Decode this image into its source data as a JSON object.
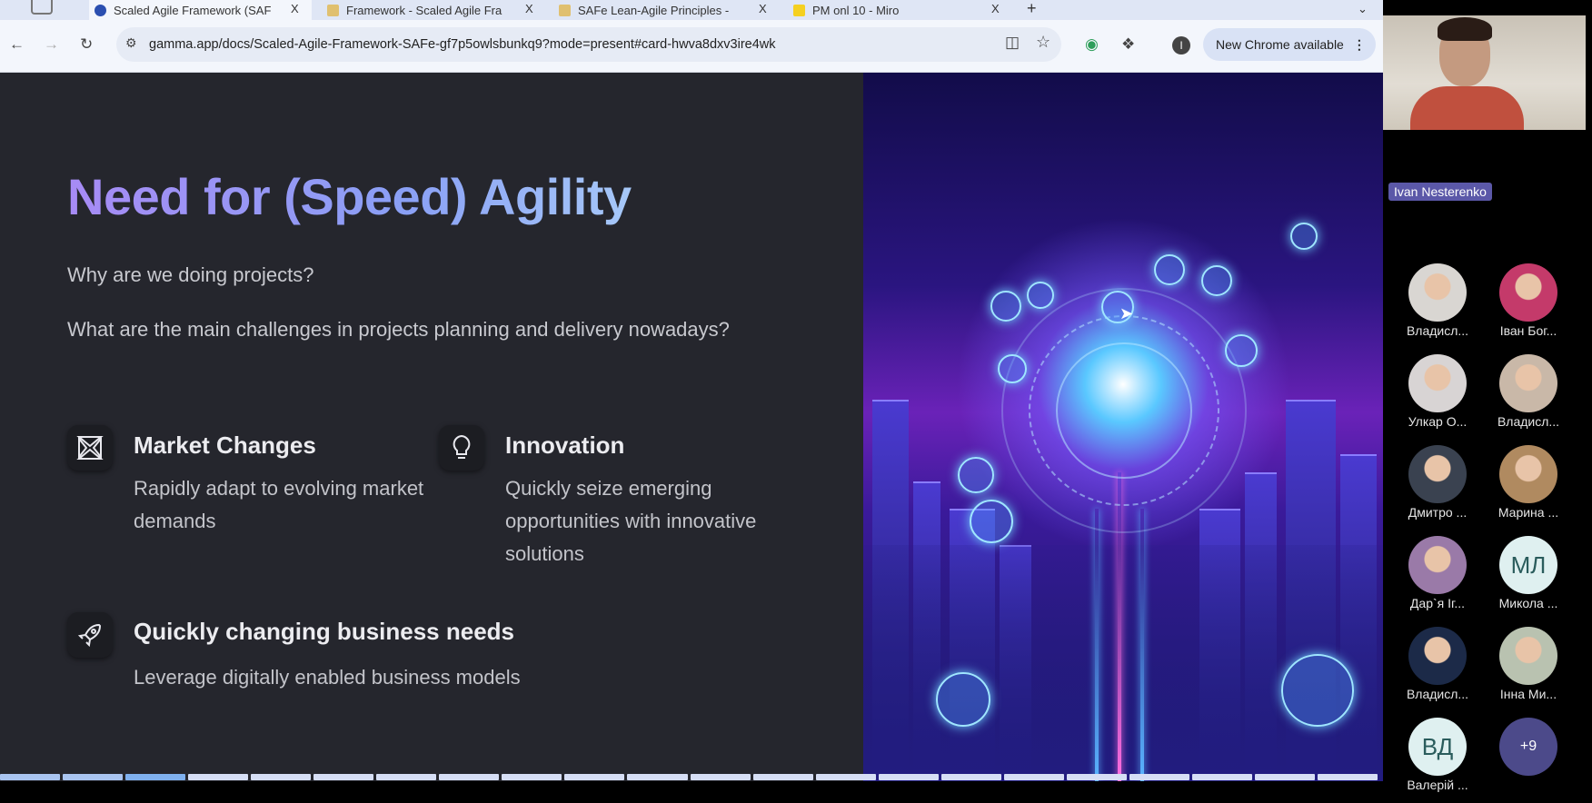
{
  "browser": {
    "tabs": [
      {
        "title": "Scaled Agile Framework (SAF",
        "active": true
      },
      {
        "title": "Framework - Scaled Agile Fra",
        "active": false
      },
      {
        "title": "SAFe Lean-Agile Principles -",
        "active": false
      },
      {
        "title": "PM onl 10 - Miro",
        "active": false
      }
    ],
    "close_glyph": "X",
    "new_tab_glyph": "+",
    "url": "gamma.app/docs/Scaled-Agile-Framework-SAFe-gf7p5owlsbunkq9?mode=present#card-hwva8dxv3ire4wk",
    "new_chrome_label": "New Chrome available",
    "profile_initial": "I"
  },
  "slide": {
    "title": "Need for (Speed) Agility",
    "questions": [
      "Why are we doing projects?",
      "What are the main challenges in projects planning and delivery nowadays?"
    ],
    "features": [
      {
        "icon": "arrows-converge-icon",
        "heading": "Market Changes",
        "description": "Rapidly adapt to evolving market demands"
      },
      {
        "icon": "lightbulb-icon",
        "heading": "Innovation",
        "description": "Quickly seize emerging opportunities with innovative solutions"
      },
      {
        "icon": "rocket-icon",
        "heading": "Quickly changing business needs",
        "description": "Leverage digitally enabled business models"
      }
    ],
    "progress": {
      "total_cards": 22,
      "current_card": 3
    }
  },
  "meeting": {
    "speaker_name": "Ivan Nesterenko",
    "participants": [
      {
        "name": "Владисл...",
        "color": "#d9d6d2"
      },
      {
        "name": "Іван Бог...",
        "color": "#c43a6a"
      },
      {
        "name": "Улкар О...",
        "color": "#d8d4d4"
      },
      {
        "name": "Владисл...",
        "color": "#c9b8a8"
      },
      {
        "name": "Дмитро ...",
        "color": "#3a4250"
      },
      {
        "name": "Марина ...",
        "color": "#b08a60"
      },
      {
        "name": "Дар`я Іг...",
        "color": "#9a7aa8"
      },
      {
        "name": "Микола ...",
        "initials": "МЛ"
      },
      {
        "name": "Владисл...",
        "color": "#1c2a48"
      },
      {
        "name": "Інна Ми...",
        "color": "#b9c2b0"
      },
      {
        "name": "Валерій ...",
        "initials": "ВД"
      }
    ],
    "more_count": "+9"
  }
}
